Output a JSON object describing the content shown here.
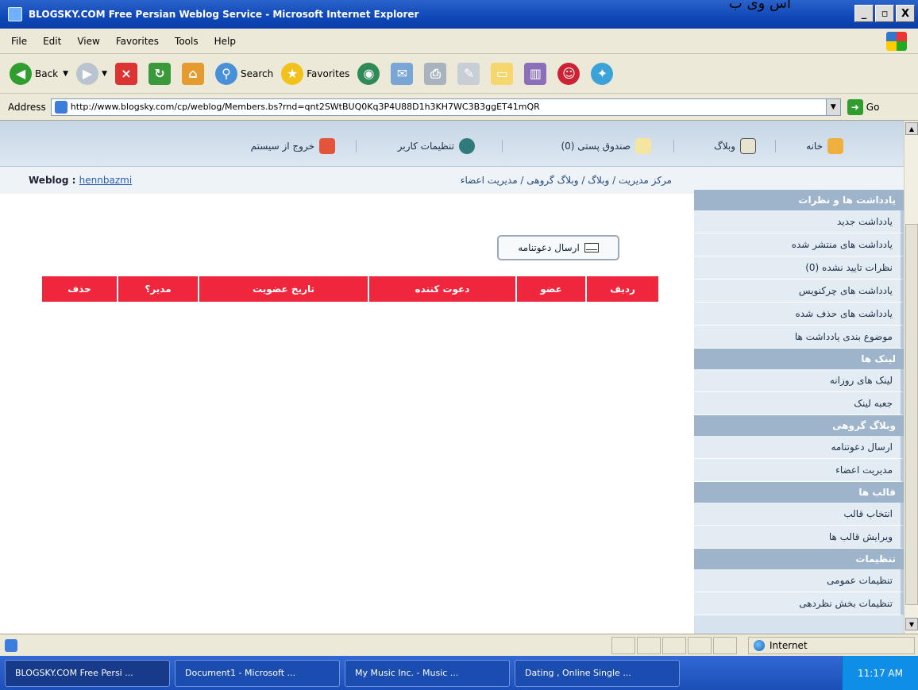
{
  "window": {
    "title": "BLOGSKY.COM Free Persian Weblog Service - Microsoft Internet Explorer",
    "corner_text": "اس وی ب",
    "buttons": [
      "_",
      "×",
      "X"
    ]
  },
  "menu": [
    "File",
    "Edit",
    "View",
    "Favorites",
    "Tools",
    "Help"
  ],
  "toolbar": {
    "back": "Back",
    "search": "Search",
    "favorites": "Favorites"
  },
  "address": {
    "label": "Address",
    "url": "http://www.blogsky.com/cp/weblog/Members.bs?rnd=qnt2SWtBUQ0Kq3P4U88D1h3KH7WC3B3ggET41mQR",
    "go": "Go"
  },
  "topnav": {
    "home": "خانه",
    "weblog": "وبلاگ",
    "inbox": "صندوق پستی (0)",
    "user_settings": "تنظیمات کاربر",
    "logout": "خروج از سیستم"
  },
  "crumb": {
    "weblog_label": "Weblog :",
    "weblog_name": "hennbazmi",
    "path": "مرکز مدیریت / وبلاگ / وبلاگ گروهی / مدیریت اعضاء"
  },
  "invite_button": "ارسال دعوتنامه",
  "members_table": {
    "headers": [
      "ردیف",
      "عضو",
      "دعوت کننده",
      "تاریخ عضویت",
      "مدیر؟",
      "حذف"
    ]
  },
  "sidebar": {
    "sections": [
      {
        "title": "یادداشت ها و نظرات",
        "items": [
          "یادداشت جدید",
          "یادداشت های منتشر شده",
          "نظرات تایید نشده (0)",
          "یادداشت های چرکنویس",
          "یادداشت های حذف شده",
          "موضوع بندی یادداشت ها"
        ]
      },
      {
        "title": "لینک ها",
        "items": [
          "لینک های روزانه",
          "جعبه لینک"
        ]
      },
      {
        "title": "وبلاگ گروهی",
        "items": [
          "ارسال دعوتنامه",
          "مدیریت اعضاء"
        ]
      },
      {
        "title": "قالب ها",
        "items": [
          "انتخاب قالب",
          "ویرایش قالب ها"
        ]
      },
      {
        "title": "تنظیمات",
        "items": [
          "تنظیمات عمومی",
          "تنظیمات بخش نظردهی"
        ]
      }
    ]
  },
  "statusbar": {
    "zone": "Internet"
  },
  "taskbar": {
    "tasks": [
      "BLOGSKY.COM Free Persi ...",
      "Document1 - Microsoft ...",
      "My Music Inc. - Music ...",
      "Dating , Online Single ..."
    ],
    "clock": "11:17 AM"
  },
  "colors": {
    "table_header": "#f0263c",
    "sidebar_head": "#9db4cb",
    "sidebar_bg": "#d6e2ee",
    "title_bar": "#0f48b8"
  }
}
